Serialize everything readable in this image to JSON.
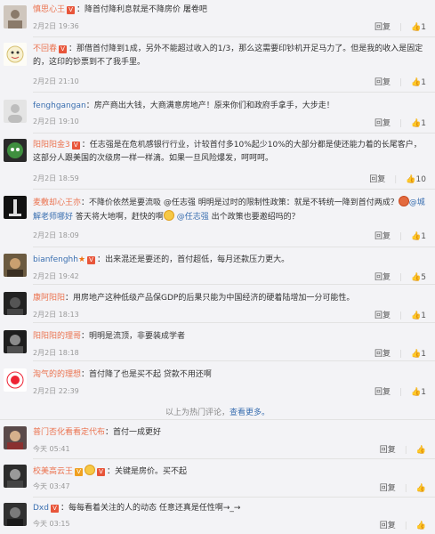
{
  "comments": [
    {
      "user": "慎思心王",
      "text": "降首付降利息就是不降房价 屠卷吧",
      "time": "2月2日 19:36",
      "reply": "回复",
      "likes": "1"
    },
    {
      "user": "不回春",
      "text": "那借首付降到1成，另外不能超过收入的1/3，那么这需要印钞机开足马力了。但是我的收入是固定的，这印的钞票到不了我手里。",
      "time": "2月2日 21:10",
      "reply": "回复",
      "likes": "1"
    },
    {
      "user": "fenghgangan",
      "text": "房产商出大钱，大商满意房地产！原来你们和政府手拿手，大步走！",
      "time": "2月2日 19:10",
      "reply": "回复",
      "likes": "1"
    },
    {
      "user": "阳阳阳金3",
      "text": "任志强是在危机感银行行业，计较首付多10%起少10%的大部分都是使还能力着的长尾客户，这部分人跟美国的次级房一样一样滴。如果一旦风险爆发，呵呵呵。",
      "time": "2月2日 18:59",
      "reply": "回复",
      "likes": "10"
    },
    {
      "user": "麦敷却心王亦",
      "text_a": "不降价依然是要流吸 @任志强 明明是过时的限制性政策：就是不转统一降到首付两成？",
      "text_mention": "@城解老师哪好",
      "text_b": "答天将大地啊，赶快的啊",
      "text_mention2": "@任志强",
      "text_c": "出个政策也要邀绍吗的？",
      "time": "2月2日 18:09",
      "reply": "回复",
      "likes": "1"
    },
    {
      "user": "bianfenghh",
      "text": "出来混还是要还的，首付超低，每月还款压力更大。",
      "time": "2月2日 19:42",
      "reply": "回复",
      "likes": "5"
    },
    {
      "user": "康阿阳阳",
      "text": "用房地产这种低级产品保GDP的后果只能为中国经济的硬着陆增加一分可能性。",
      "time": "2月2日 18:13",
      "reply": "回复",
      "likes": "1"
    },
    {
      "user": "阳阳阳的理哥",
      "text": "明明是流顶，非要装成学者",
      "time": "2月2日 18:18",
      "reply": "回复",
      "likes": "1"
    },
    {
      "user": "淘气的的理想",
      "text": "首付降了也是买不起 贷款不用还啊",
      "time": "2月2日 22:39",
      "reply": "回复",
      "likes": "1"
    }
  ],
  "hot_notice": {
    "text": "以上为热门评论，",
    "more": "查看更多。"
  },
  "recent": [
    {
      "user": "普门否化看看定代布",
      "text": "首付一成更好",
      "time": "今天 05:41",
      "reply": "回复",
      "likes": "赞"
    },
    {
      "user": "校美高云王",
      "text": "关键是房价。买不起",
      "time": "今天 03:47",
      "reply": "回复",
      "likes": "赞"
    },
    {
      "user": "Dxd",
      "text": "每每看着关注的人的动态 任意还真是任性啊→_→",
      "time": "今天 03:15",
      "reply": "回复",
      "likes": "赞"
    }
  ]
}
